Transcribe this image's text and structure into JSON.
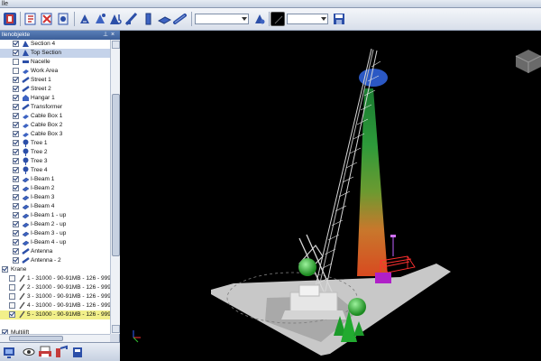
{
  "window": {
    "title": "lle"
  },
  "toolbar": {
    "buttons": [
      {
        "name": "app-menu-icon"
      },
      {
        "name": "import-icon"
      },
      {
        "name": "delete-icon"
      },
      {
        "name": "move-icon"
      },
      {
        "name": "rotate-icon"
      },
      {
        "name": "crane-hook-icon"
      },
      {
        "name": "boom-icon"
      },
      {
        "name": "column-icon"
      },
      {
        "name": "beam-icon"
      },
      {
        "name": "pipe-icon"
      }
    ],
    "combo1_value": "",
    "combo2_value": ""
  },
  "panel": {
    "header": "llenobjekte",
    "items": [
      {
        "label": "Section 4",
        "checked": true,
        "indent": 2,
        "icon": "section-icon"
      },
      {
        "label": "Top Section",
        "checked": true,
        "indent": 2,
        "icon": "section-icon",
        "selected": true
      },
      {
        "label": "Nacelle",
        "checked": false,
        "indent": 2,
        "icon": "nacelle-icon"
      },
      {
        "label": "Work Area",
        "checked": false,
        "indent": 2,
        "icon": "work-area-icon"
      },
      {
        "label": "Street 1",
        "checked": true,
        "indent": 2,
        "icon": "street-icon"
      },
      {
        "label": "Street 2",
        "checked": true,
        "indent": 2,
        "icon": "street-icon"
      },
      {
        "label": "Hangar 1",
        "checked": true,
        "indent": 2,
        "icon": "hangar-icon"
      },
      {
        "label": "Transformer",
        "checked": true,
        "indent": 2,
        "icon": "transformer-icon"
      },
      {
        "label": "Cable Box 1",
        "checked": true,
        "indent": 2,
        "icon": "cable-box-icon"
      },
      {
        "label": "Cable Box 2",
        "checked": true,
        "indent": 2,
        "icon": "cable-box-icon"
      },
      {
        "label": "Cable Box 3",
        "checked": true,
        "indent": 2,
        "icon": "cable-box-icon"
      },
      {
        "label": "Tree 1",
        "checked": true,
        "indent": 2,
        "icon": "tree-icon"
      },
      {
        "label": "Tree 2",
        "checked": true,
        "indent": 2,
        "icon": "tree-icon"
      },
      {
        "label": "Tree 3",
        "checked": true,
        "indent": 2,
        "icon": "tree-icon"
      },
      {
        "label": "Tree 4",
        "checked": true,
        "indent": 2,
        "icon": "tree-icon"
      },
      {
        "label": "I-Beam 1",
        "checked": true,
        "indent": 2,
        "icon": "i-beam-icon"
      },
      {
        "label": "I-Beam 2",
        "checked": true,
        "indent": 2,
        "icon": "i-beam-icon"
      },
      {
        "label": "I-Beam 3",
        "checked": true,
        "indent": 2,
        "icon": "i-beam-icon"
      },
      {
        "label": "I-Beam 4",
        "checked": true,
        "indent": 2,
        "icon": "i-beam-icon"
      },
      {
        "label": "I-Beam 1 - up",
        "checked": true,
        "indent": 2,
        "icon": "i-beam-icon"
      },
      {
        "label": "I-Beam 2 - up",
        "checked": true,
        "indent": 2,
        "icon": "i-beam-icon"
      },
      {
        "label": "I-Beam 3 - up",
        "checked": true,
        "indent": 2,
        "icon": "i-beam-icon"
      },
      {
        "label": "I-Beam 4 - up",
        "checked": true,
        "indent": 2,
        "icon": "i-beam-icon"
      },
      {
        "label": "Antenna",
        "checked": true,
        "indent": 2,
        "icon": "antenna-icon"
      },
      {
        "label": "Antenna - 2",
        "checked": true,
        "indent": 2,
        "icon": "antenna-icon"
      },
      {
        "label": "Krane",
        "checked": true,
        "indent": 1,
        "icon": ""
      },
      {
        "label": "1 - 31000 - 90-91MB - 126 - 999 -",
        "checked": false,
        "indent": 3,
        "icon": "crane-item-icon"
      },
      {
        "label": "2 - 31000 - 90-91MB - 126 - 999 -",
        "checked": false,
        "indent": 3,
        "icon": "crane-item-icon"
      },
      {
        "label": "3 - 31000 - 90-91MB - 126 - 999 -",
        "checked": false,
        "indent": 3,
        "icon": "crane-item-icon"
      },
      {
        "label": "4 - 31000 - 90-91MB - 126 - 999 -",
        "checked": false,
        "indent": 3,
        "icon": "crane-item-icon"
      },
      {
        "label": "5 - 31000 - 90-91MB - 126 - 999 -",
        "checked": true,
        "indent": 3,
        "icon": "crane-item-icon",
        "highlighted": true
      },
      {
        "label": "",
        "checked": false,
        "indent": 1,
        "icon": ""
      },
      {
        "label": "Multilift",
        "checked": true,
        "indent": 1,
        "icon": ""
      }
    ]
  },
  "colors": {
    "toolbar_icon_blue": "#2c4fa8",
    "highlight_yellow": "#f2f08a",
    "selection_blue": "#c5d3ea",
    "viewport_bg": "#000000"
  }
}
